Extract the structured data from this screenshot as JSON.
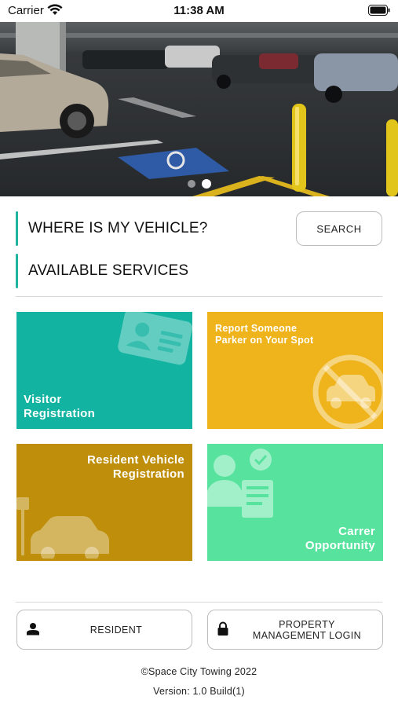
{
  "status_bar": {
    "carrier": "Carrier",
    "time": "11:38 AM"
  },
  "hero": {
    "slide_count": 2,
    "active_slide": 2
  },
  "vehicle_section": {
    "title": "WHERE IS MY VEHICLE?",
    "search_label": "SEARCH"
  },
  "services_section": {
    "title": "AVAILABLE SERVICES"
  },
  "tiles": {
    "visitor": {
      "label": "Visitor\nRegistration",
      "color": "#12b3a0",
      "icon": "id-card-icon"
    },
    "report": {
      "label": "Report Someone\nParker on Your Spot",
      "color": "#efb31b",
      "icon": "no-parking-icon"
    },
    "resident": {
      "label": "Resident Vehicle\nRegistration",
      "color": "#bf8f0c",
      "icon": "parked-car-icon"
    },
    "career": {
      "label": "Carrer\nOpportunity",
      "color": "#57e39e",
      "icon": "job-applicant-icon"
    }
  },
  "bottom": {
    "resident_label": "RESIDENT",
    "property_label": "PROPERTY\nMANAGEMENT LOGIN"
  },
  "footer": {
    "copyright": "©Space City Towing 2022",
    "version": "Version: 1.0 Build(1)"
  },
  "colors": {
    "accent": "#1fb3a1"
  }
}
